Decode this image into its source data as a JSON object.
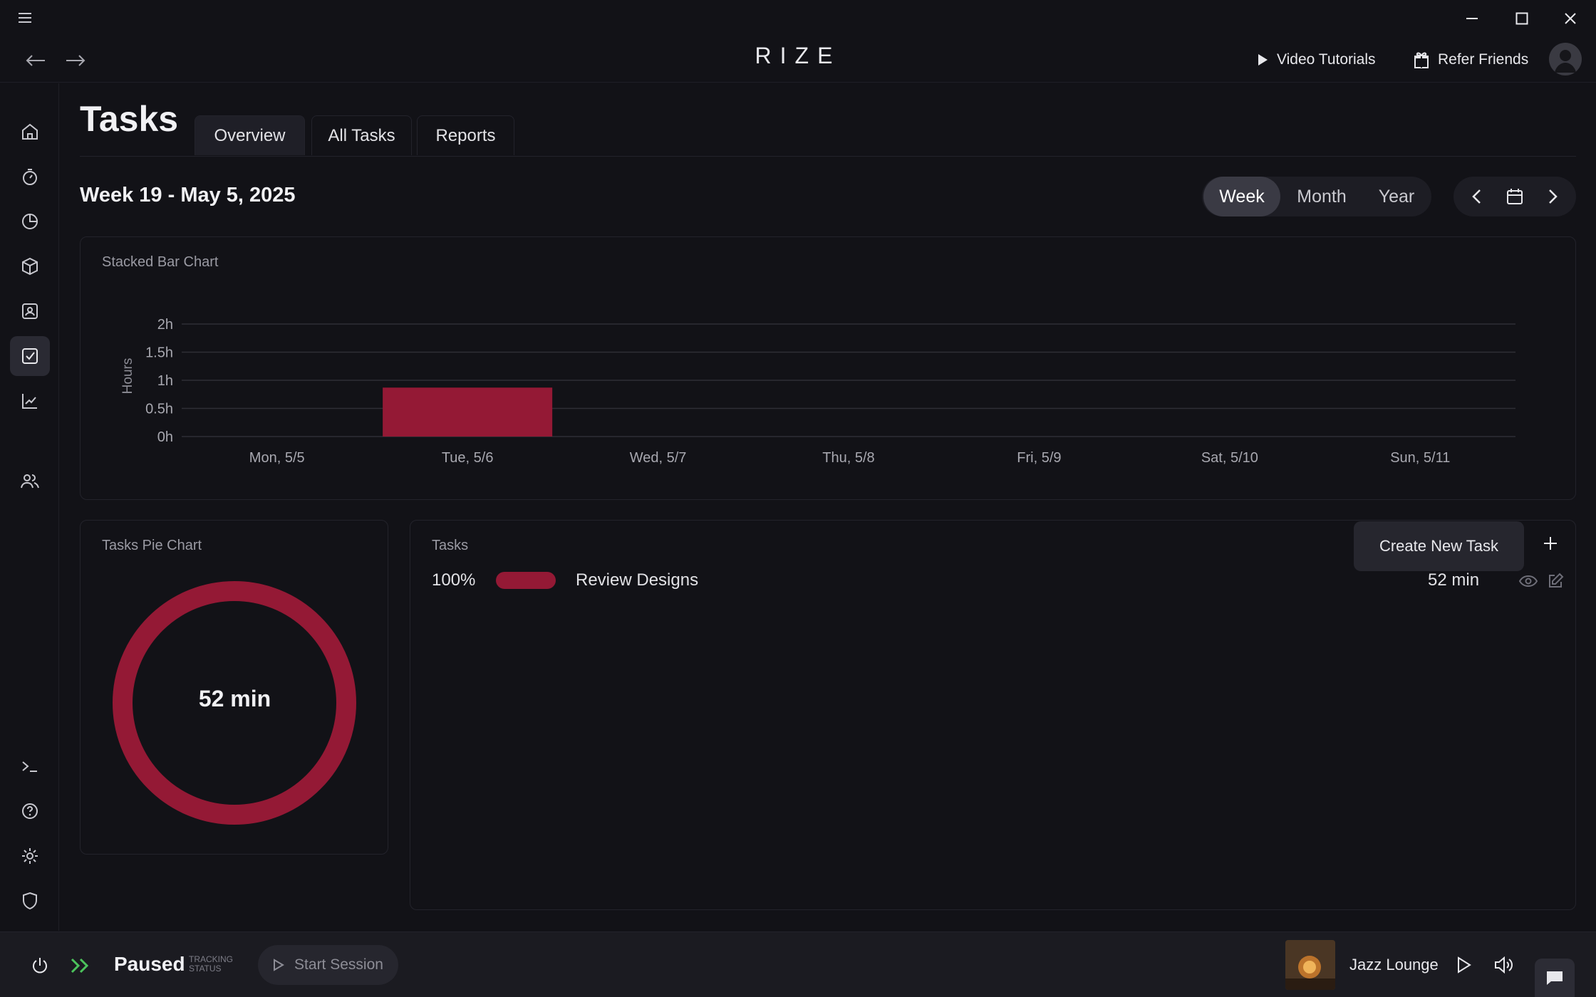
{
  "app": {
    "brand": "RIZE"
  },
  "topbar": {
    "video_tutorials": "Video Tutorials",
    "refer_friends": "Refer Friends"
  },
  "page": {
    "title": "Tasks",
    "tabs": [
      {
        "label": "Overview",
        "active": true
      },
      {
        "label": "All Tasks",
        "active": false
      },
      {
        "label": "Reports",
        "active": false
      }
    ],
    "week_title": "Week 19 - May 5, 2025",
    "range": {
      "week": "Week",
      "month": "Month",
      "year": "Year",
      "selected": "Week"
    }
  },
  "bar_card": {
    "title": "Stacked Bar Chart"
  },
  "chart_data": {
    "type": "bar",
    "ylabel": "Hours",
    "categories": [
      "Mon, 5/5",
      "Tue, 5/6",
      "Wed, 5/7",
      "Thu, 5/8",
      "Fri, 5/9",
      "Sat, 5/10",
      "Sun, 5/11"
    ],
    "values": [
      0,
      0.87,
      0,
      0,
      0,
      0,
      0
    ],
    "yticks": [
      "0h",
      "0.5h",
      "1h",
      "1.5h",
      "2h"
    ],
    "ylim": [
      0,
      2
    ],
    "grid": true,
    "color": "#941935"
  },
  "pie_card": {
    "title": "Tasks Pie Chart",
    "center_label": "52 min",
    "color": "#941935"
  },
  "tasks_card": {
    "title": "Tasks",
    "tooltip": "Create New Task",
    "items": [
      {
        "percent": "100%",
        "name": "Review Designs",
        "duration": "52 min",
        "color": "#941935"
      }
    ]
  },
  "bottombar": {
    "status": "Paused",
    "status_caption_1": "TRACKING",
    "status_caption_2": "STATUS",
    "start_session": "Start Session",
    "music_title": "Jazz Lounge"
  }
}
